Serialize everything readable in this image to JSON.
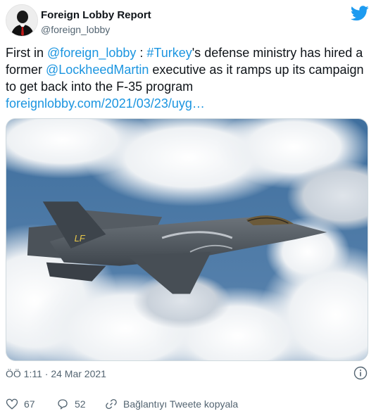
{
  "account": {
    "display_name": "Foreign Lobby Report",
    "handle": "@foreign_lobby"
  },
  "tweet": {
    "segments": [
      {
        "text": "First in ",
        "link": false
      },
      {
        "text": "@foreign_lobby",
        "link": true
      },
      {
        "text": " : ",
        "link": false
      },
      {
        "text": "#Turkey",
        "link": true
      },
      {
        "text": "'s defense ministry has hired a former ",
        "link": false
      },
      {
        "text": "@LockheedMartin",
        "link": true
      },
      {
        "text": " executive as it ramps up its campaign to get back into the F-35 program ",
        "link": false
      },
      {
        "text": "foreignlobby.com/2021/03/23/uyg…",
        "link": true
      }
    ]
  },
  "media": {
    "aircraft_tail_code": "LF"
  },
  "meta": {
    "timestamp": "ÖÖ 1:11 · 24 Mar 2021"
  },
  "actions": {
    "likes": "67",
    "replies": "52",
    "share_label": "Bağlantıyı Tweete kopyala"
  },
  "colors": {
    "link": "#1b95e0",
    "twitter_blue": "#1d9bf0",
    "secondary_text": "#536471"
  },
  "icons": {
    "brand": "twitter-bird-icon",
    "info": "info-icon",
    "like": "heart-icon",
    "reply": "reply-bubble-icon",
    "share": "link-icon"
  }
}
